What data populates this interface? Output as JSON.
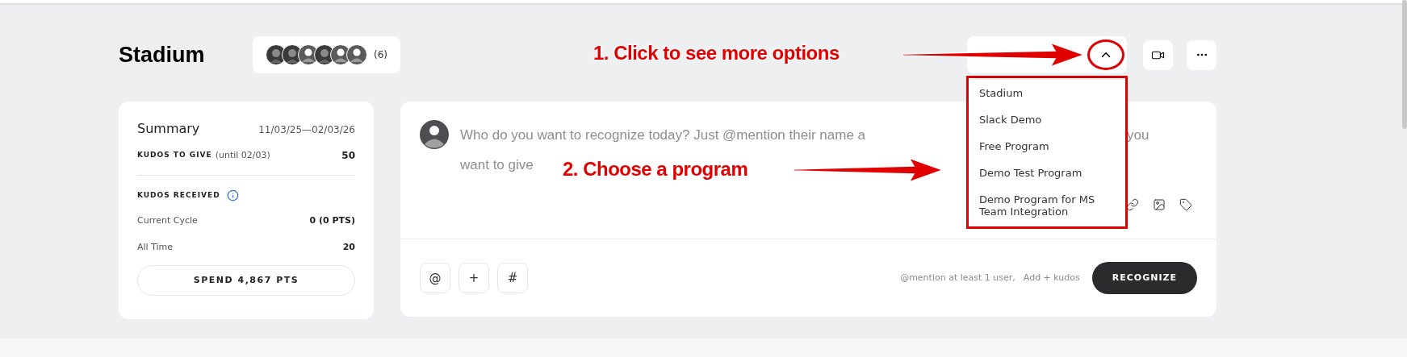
{
  "header": {
    "title": "Stadium",
    "member_count": "(6)",
    "avatars": [
      {
        "kind": "photo"
      },
      {
        "kind": "photo"
      },
      {
        "kind": "default"
      },
      {
        "kind": "photo"
      },
      {
        "kind": "default"
      },
      {
        "kind": "default"
      }
    ]
  },
  "program_menu": {
    "expanded": true,
    "items": [
      "Stadium",
      "Slack Demo",
      "Free Program",
      "Demo Test Program",
      "Demo Program for MS Team Integration"
    ]
  },
  "summary": {
    "title": "Summary",
    "period": "11/03/25—02/03/26",
    "kudos_to_give": {
      "label": "KUDOS TO GIVE",
      "note": "(until 02/03)",
      "value": "50"
    },
    "kudos_received": {
      "label": "KUDOS RECEIVED",
      "rows": [
        {
          "label": "Current Cycle",
          "value": "0 (0 PTS)"
        },
        {
          "label": "All Time",
          "value": "20"
        }
      ]
    },
    "spend_button": "SPEND 4,867 PTS"
  },
  "composer": {
    "placeholder_visible": [
      "Who do you want to recognize today? Just @mention their name a",
      "you",
      "want to give"
    ],
    "tools": [
      "@",
      "+",
      "#"
    ],
    "hints": [
      "@mention at least 1 user,",
      "Add + kudos"
    ],
    "submit": "RECOGNIZE"
  },
  "annotations": [
    {
      "text": "1. Click to see more options"
    },
    {
      "text": "2. Choose a program"
    }
  ]
}
